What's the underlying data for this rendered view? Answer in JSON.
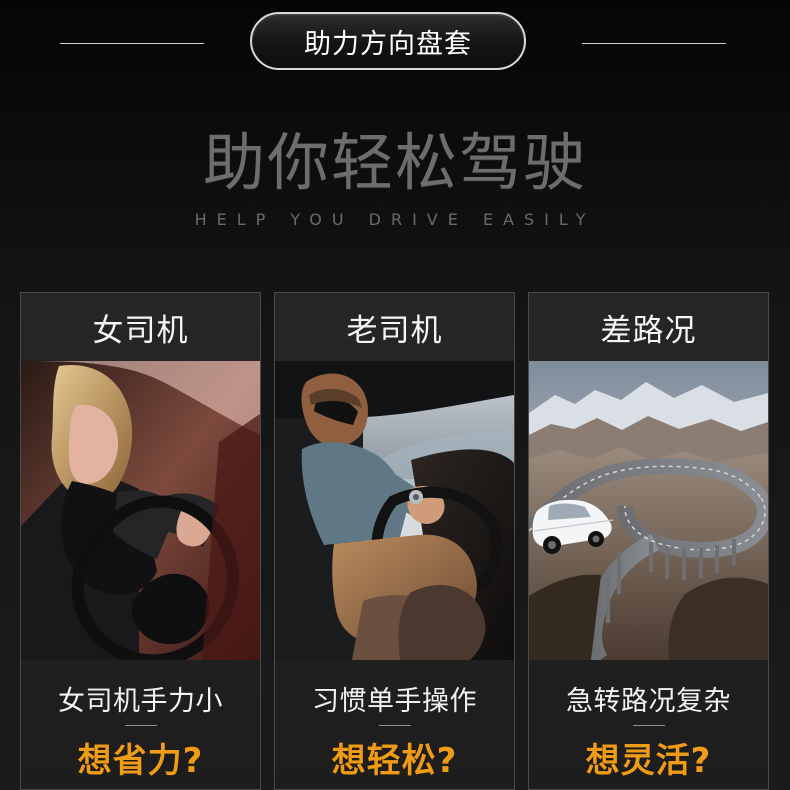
{
  "badge": {
    "title": "助力方向盘套"
  },
  "hero": {
    "title": "助你轻松驾驶",
    "subtitle": "HELP YOU DRIVE EASILY"
  },
  "cards": [
    {
      "title": "女司机",
      "subtitle": "女司机手力小",
      "question": "想省力?"
    },
    {
      "title": "老司机",
      "subtitle": "习惯单手操作",
      "question": "想轻松?"
    },
    {
      "title": "差路况",
      "subtitle": "急转路况复杂",
      "question": "想灵活?"
    }
  ],
  "colors": {
    "background": "#151515",
    "badge_border": "#d9d9d9",
    "accent": "#ef9b16",
    "card_border": "#4b4b4b"
  }
}
